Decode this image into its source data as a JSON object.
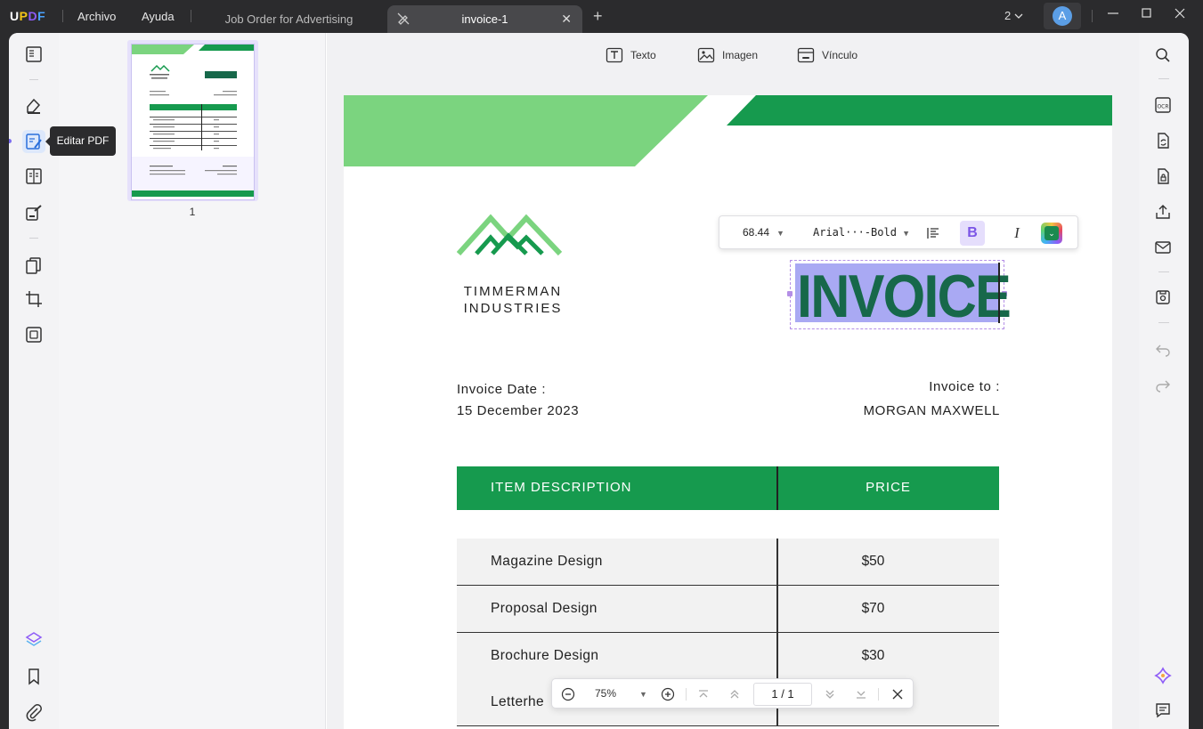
{
  "app": {
    "logo": "UPDF",
    "menu": [
      "Archivo",
      "Ayuda"
    ],
    "tabs": [
      {
        "label": "Job Order for Advertising"
      },
      {
        "label": "invoice-1"
      }
    ],
    "window_count": "2",
    "avatar_letter": "A"
  },
  "sidebar": {
    "tooltip": "Editar PDF"
  },
  "thumbnails": {
    "page_number": "1"
  },
  "edit_tools": {
    "text": "Texto",
    "image": "Imagen",
    "link": "Vínculo"
  },
  "format_bar": {
    "font_size": "68.44",
    "font_name": "Arial···-Bold",
    "bold": "B",
    "italic": "I"
  },
  "document": {
    "company_line1": "TIMMERMAN",
    "company_line2": "INDUSTRIES",
    "title": "INVOICE",
    "invoice_date_label": "Invoice Date :",
    "invoice_date": "15 December 2023",
    "invoice_to_label": "Invoice to :",
    "invoice_to": "MORGAN MAXWELL",
    "table": {
      "headers": [
        "ITEM DESCRIPTION",
        "PRICE"
      ],
      "rows": [
        [
          "Magazine Design",
          "$50"
        ],
        [
          "Proposal Design",
          "$70"
        ],
        [
          "Brochure Design",
          "$30"
        ],
        [
          "Letterhe",
          ""
        ]
      ]
    }
  },
  "zoom_bar": {
    "zoom": "75%",
    "page_current": "1",
    "page_total": "1"
  },
  "colors": {
    "brand_green": "#169a4e",
    "light_green": "#7bd47f",
    "selection": "#a9a9f3",
    "accent_purple": "#7b55e6"
  }
}
